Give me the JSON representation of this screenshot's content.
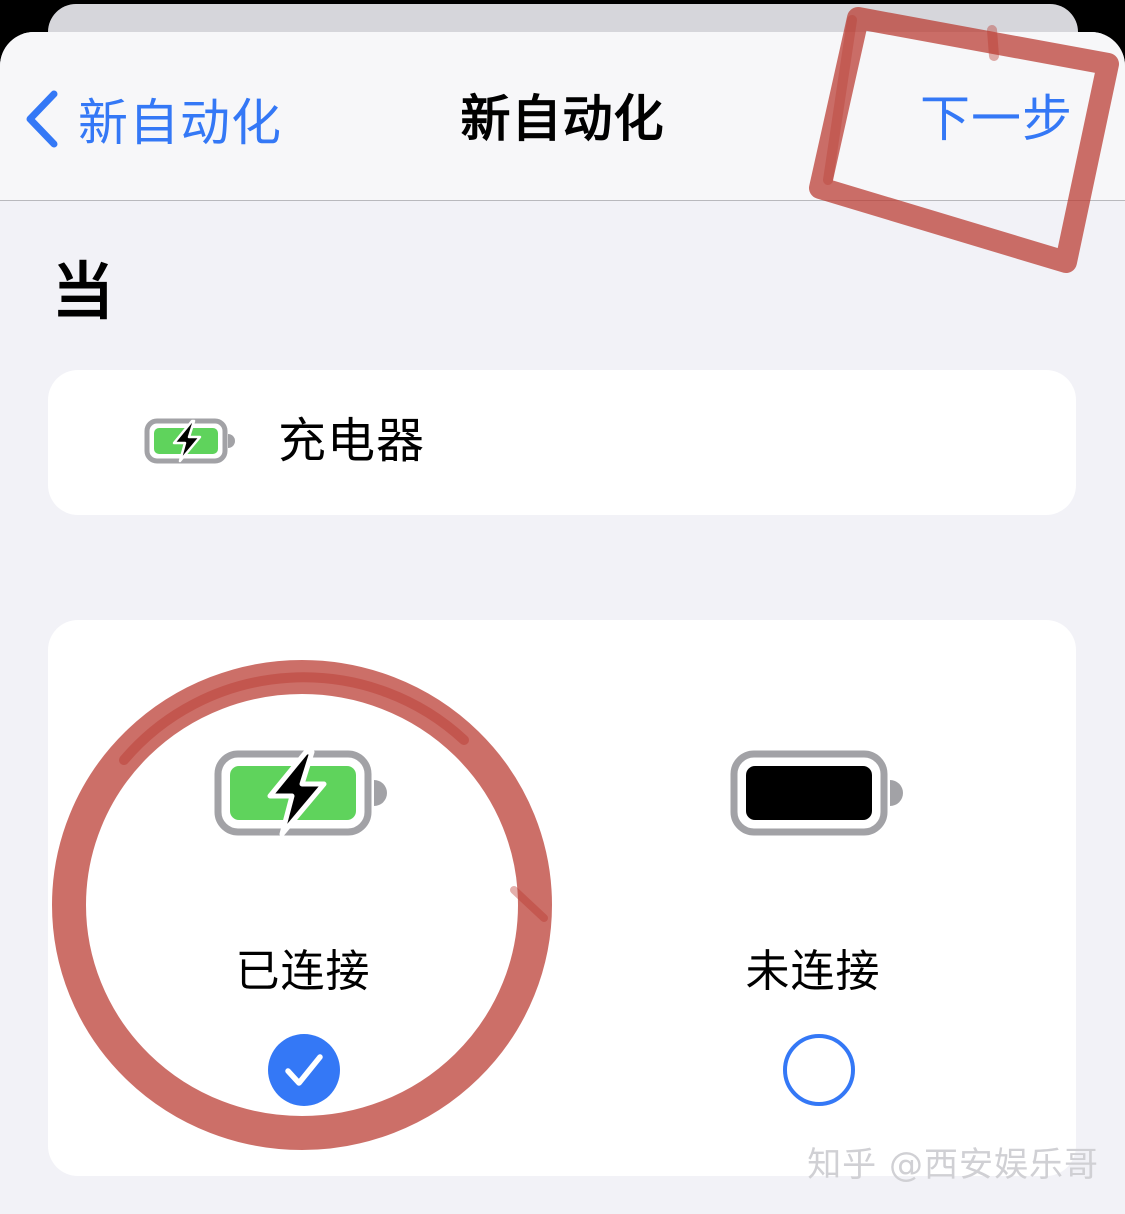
{
  "nav": {
    "back_label": "新自动化",
    "title": "新自动化",
    "next_label": "下一步"
  },
  "section": {
    "title": "当"
  },
  "trigger": {
    "label": "充电器",
    "icon": "battery-charging-icon"
  },
  "options": [
    {
      "label": "已连接",
      "icon": "battery-charging-icon",
      "selected": true
    },
    {
      "label": "未连接",
      "icon": "battery-full-icon",
      "selected": false
    }
  ],
  "watermark": "知乎 @西安娱乐哥",
  "colors": {
    "accent": "#3478f6",
    "battery_green": "#5fd35c",
    "annotation": "#b8382e"
  }
}
